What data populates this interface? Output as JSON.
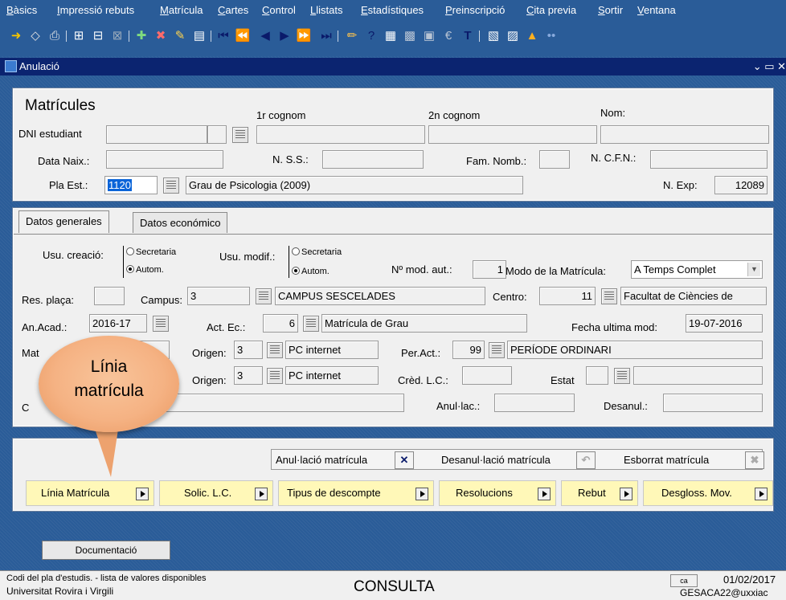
{
  "menu": [
    "Bàsics",
    "Impressió rebuts",
    "Matrícula",
    "Cartes",
    "Control",
    "Llistats",
    "Estadístiques",
    "Preinscripció",
    "Cita previa",
    "Sortir",
    "Ventana"
  ],
  "window": {
    "title": "Anulació",
    "controls": "⌄ ▭ ✕"
  },
  "header": {
    "title": "Matrícules",
    "col_cognom1": "1r cognom",
    "col_cognom2": "2n cognom",
    "col_nom": "Nom:",
    "dni_label": "DNI estudiant",
    "data_naix_label": "Data Naix.:",
    "nss_label": "N. S.S.:",
    "fam_label": "Fam. Nomb.:",
    "ncfn_label": "N. C.F.N.:",
    "pla_label": "Pla Est.:",
    "pla_value": "1120",
    "pla_desc": "Grau de Psicologia (2009)",
    "nexp_label": "N. Exp:",
    "nexp_value": "12089"
  },
  "tabs": {
    "general": "Datos generales",
    "economic": "Datos económico"
  },
  "general": {
    "usu_creacio_label": "Usu. creació:",
    "usu_modif_label": "Usu. modif.:",
    "opt_secretaria": "Secretaria",
    "opt_autom": "Autom.",
    "nmod_label": "Nº mod. aut.:",
    "nmod_value": "1",
    "modo_label": "Modo de la Matrícula:",
    "modo_value": "A Temps Complet",
    "res_label": "Res. plaça:",
    "campus_label": "Campus:",
    "campus_value": "3",
    "campus_desc": "CAMPUS SESCELADES",
    "centro_label": "Centro:",
    "centro_value": "11",
    "centro_desc": "Facultat de Ciències de",
    "anacad_label": "An.Acad.:",
    "anacad_value": "2016-17",
    "actec_label": "Act. Ec.:",
    "actec_value": "6",
    "actec_desc": "Matrícula de Grau",
    "fecha_label": "Fecha ultima mod:",
    "fecha_value": "19-07-2016",
    "mat_label": "Mat",
    "origen_label": "Origen:",
    "origen1_value": "3",
    "origen1_desc": "PC internet",
    "peract_label": "Per.Act.:",
    "peract_value": "99",
    "peract_desc": "PERÍODE ORDINARI",
    "origen2_value": "3",
    "origen2_desc": "PC internet",
    "credlc_label": "Crèd. L.C.:",
    "estat_label": "Estat",
    "co_label": "C",
    "anullac_label": "Anul·lac.:",
    "desanul_label": "Desanul.:"
  },
  "actions": {
    "anul_label": "Anul·lació matrícula",
    "desanul_label": "Desanul·lació matrícula",
    "esborrat_label": "Esborrat matrícula",
    "buttons": [
      "Línia Matrícula",
      "Solic. L.C.",
      "Tipus de descompte",
      "Resolucions",
      "Rebut",
      "Desgloss. Mov."
    ]
  },
  "documentacio": "Documentació",
  "callout": {
    "line1": "Línia",
    "line2": "matrícula"
  },
  "status": {
    "hint": "Codi del pla d'estudis. - lista de valores disponibles",
    "org": "Universitat Rovira i Virgili",
    "mode": "CONSULTA",
    "lang": "ca",
    "date": "01/02/2017",
    "user": "GESACA22@uxxiac"
  }
}
